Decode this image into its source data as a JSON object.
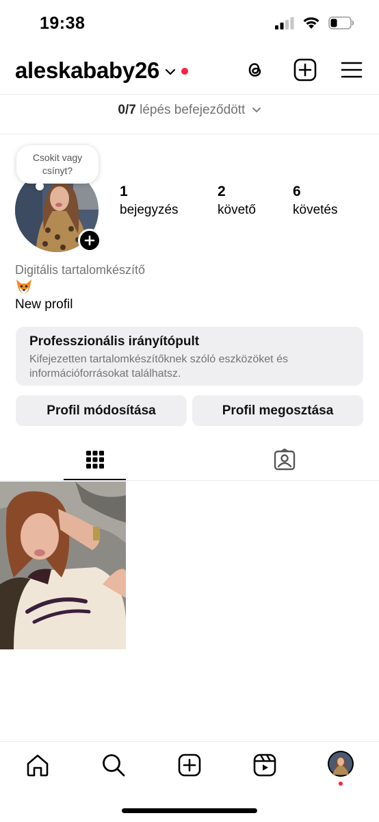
{
  "status_bar": {
    "time": "19:38"
  },
  "header": {
    "username": "aleskababy26"
  },
  "steps": {
    "done": "0/7",
    "text": "lépés befejeződött"
  },
  "note": {
    "text": "Csokit vagy csínyt?"
  },
  "stats": [
    {
      "value": "1",
      "label": "bejegyzés"
    },
    {
      "value": "2",
      "label": "követő"
    },
    {
      "value": "6",
      "label": "követés"
    }
  ],
  "bio": {
    "category": "Digitális tartalomkészítő",
    "emoji_icon": "fox-emoji-icon",
    "text": "New profil"
  },
  "dashboard": {
    "title": "Professzionális irányítópult",
    "description": "Kifejezetten tartalomkészítőknek szóló eszközöket és információforrásokat találhatsz."
  },
  "buttons": {
    "edit": "Profil módosítása",
    "share": "Profil megosztása"
  },
  "colors": {
    "notification": "#ff1f3d",
    "button_bg": "#efeff1",
    "secondary_text": "#737373"
  }
}
